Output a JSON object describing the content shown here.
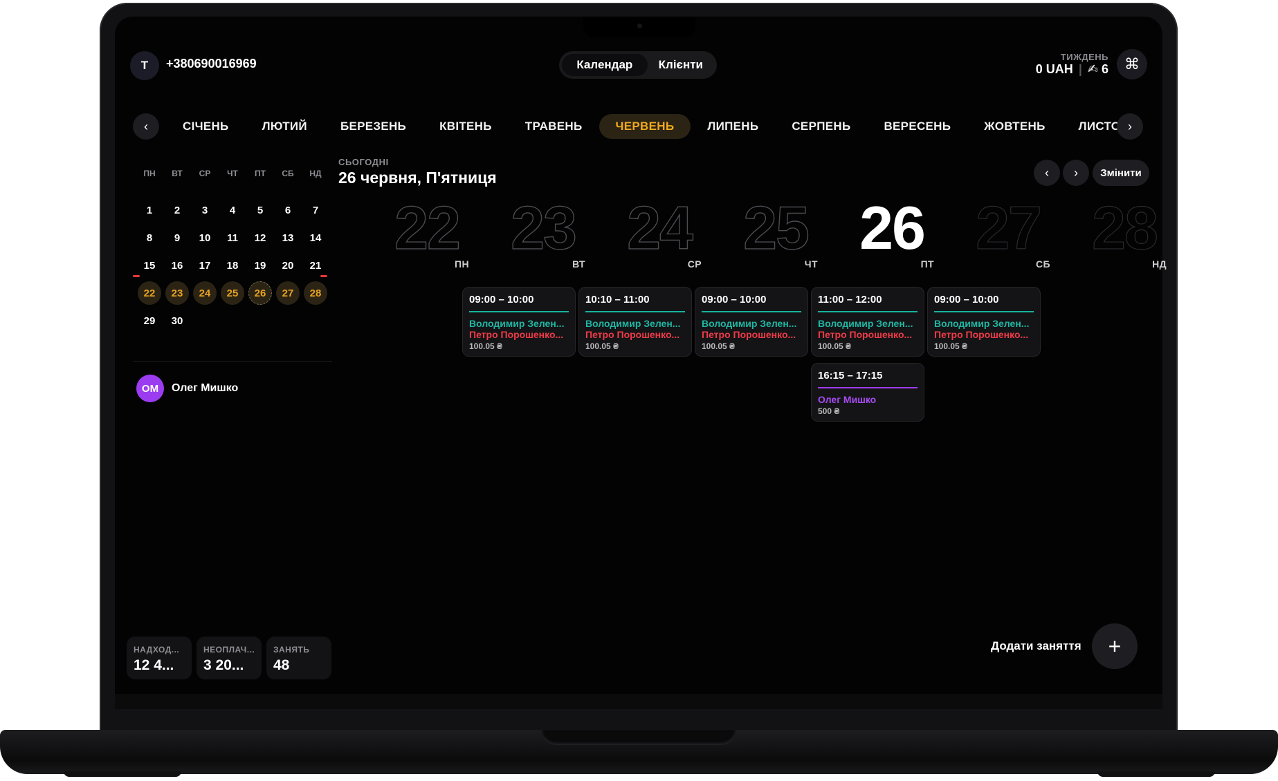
{
  "user": {
    "initial": "T",
    "phone": "+380690016969"
  },
  "tabs": {
    "calendar": "Календар",
    "clients": "Клієнти"
  },
  "week_summary": {
    "label": "ТИЖДЕНЬ",
    "income": "0 UAH",
    "separator": "|",
    "icon": "✍",
    "count": "6"
  },
  "command_icon": "⌘",
  "months": [
    "СІЧЕНЬ",
    "ЛЮТИЙ",
    "БЕРЕЗЕНЬ",
    "КВІТЕНЬ",
    "ТРАВЕНЬ",
    "ЧЕРВЕНЬ",
    "ЛИПЕНЬ",
    "СЕРПЕНЬ",
    "ВЕРЕСЕНЬ",
    "ЖОВТЕНЬ",
    "ЛИСТОПАД"
  ],
  "active_month": "ЧЕРВЕНЬ",
  "mini_calendar": {
    "weekdays": [
      "ПН",
      "ВТ",
      "СР",
      "ЧТ",
      "ПТ",
      "СБ",
      "НД"
    ],
    "weeks": [
      [
        "1",
        "2",
        "3",
        "4",
        "5",
        "6",
        "7"
      ],
      [
        "8",
        "9",
        "10",
        "11",
        "12",
        "13",
        "14"
      ],
      [
        "15",
        "16",
        "17",
        "18",
        "19",
        "20",
        "21"
      ],
      [
        "22",
        "23",
        "24",
        "25",
        "26",
        "27",
        "28"
      ],
      [
        "29",
        "30",
        "",
        "",
        "",
        "",
        ""
      ]
    ],
    "selected_week_index": 3,
    "today": "26"
  },
  "clients": [
    {
      "initials": "ОМ",
      "name": "Олег Мишко"
    }
  ],
  "today": {
    "label": "СЬОГОДНІ",
    "date": "26 червня, П'ятниця"
  },
  "change_button": "Змінити",
  "week_days": [
    {
      "num": "22",
      "name": "ПН"
    },
    {
      "num": "23",
      "name": "ВТ"
    },
    {
      "num": "24",
      "name": "СР"
    },
    {
      "num": "25",
      "name": "ЧТ"
    },
    {
      "num": "26",
      "name": "ПТ"
    },
    {
      "num": "27",
      "name": "СБ"
    },
    {
      "num": "28",
      "name": "НД"
    }
  ],
  "appointments": [
    {
      "day": "ВТ",
      "time": "09:00 – 10:00",
      "teacher": "Володимир Зелен...",
      "student": "Петро Порошенко...",
      "price": "100.05 ₴"
    },
    {
      "day": "СР",
      "time": "10:10 – 11:00",
      "teacher": "Володимир Зелен...",
      "student": "Петро Порошенко...",
      "price": "100.05 ₴"
    },
    {
      "day": "ЧТ",
      "time": "09:00 – 10:00",
      "teacher": "Володимир Зелен...",
      "student": "Петро Порошенко...",
      "price": "100.05 ₴"
    },
    {
      "day": "ПТ",
      "time": "11:00 – 12:00",
      "teacher": "Володимир Зелен...",
      "student": "Петро Порошенко...",
      "price": "100.05 ₴"
    },
    {
      "day": "СБ",
      "time": "09:00 – 10:00",
      "teacher": "Володимир Зелен...",
      "student": "Петро Порошенко...",
      "price": "100.05 ₴"
    },
    {
      "day": "ПТ",
      "time": "16:15 – 17:15",
      "client": "Олег Мишко",
      "price": "500 ₴"
    }
  ],
  "stats": [
    {
      "label": "НАДХОД...",
      "value": "12 4..."
    },
    {
      "label": "НЕОПЛАЧ...",
      "value": "3 20..."
    },
    {
      "label": "ЗАНЯТЬ",
      "value": "48"
    }
  ],
  "add_lesson": {
    "label": "Додати заняття",
    "icon": "+"
  }
}
